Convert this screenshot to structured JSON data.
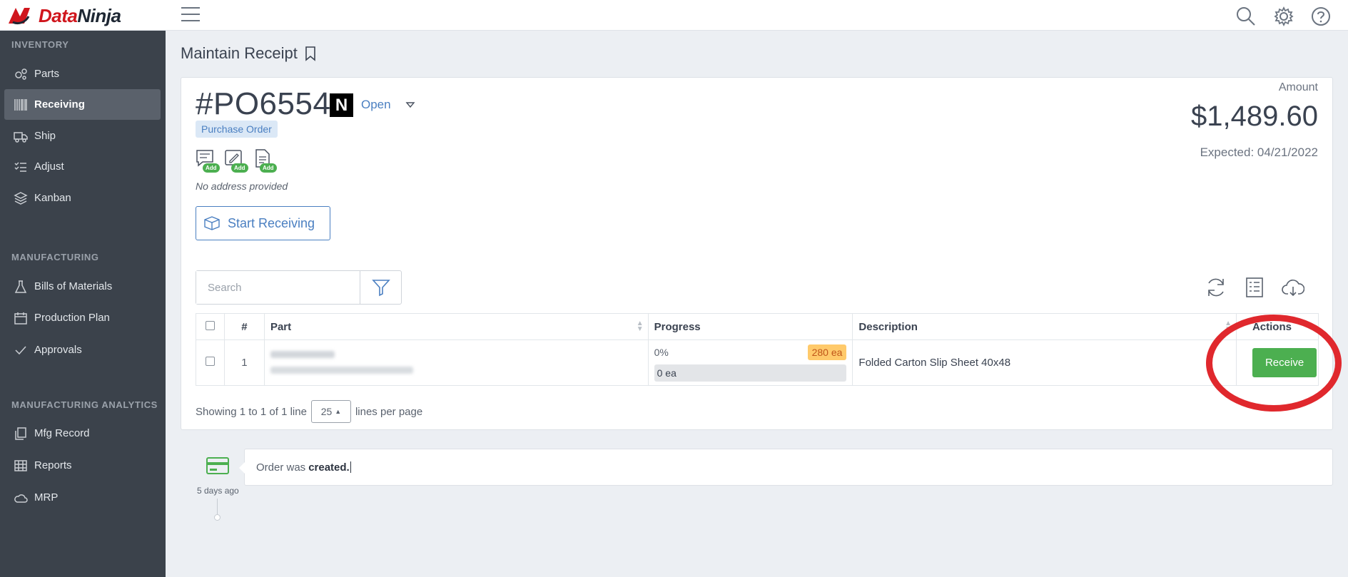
{
  "brand": {
    "name_part1": "Data",
    "name_part2": "Ninja"
  },
  "sidebar": {
    "sections": [
      {
        "title": "INVENTORY",
        "items": [
          {
            "label": "Parts",
            "icon": "gears-icon"
          },
          {
            "label": "Receiving",
            "icon": "barcode-icon",
            "active": true
          },
          {
            "label": "Ship",
            "icon": "truck-icon"
          },
          {
            "label": "Adjust",
            "icon": "checklist-icon"
          },
          {
            "label": "Kanban",
            "icon": "layers-icon"
          }
        ]
      },
      {
        "title": "MANUFACTURING",
        "items": [
          {
            "label": "Bills of Materials",
            "icon": "flask-icon"
          },
          {
            "label": "Production Plan",
            "icon": "calendar-icon"
          },
          {
            "label": "Approvals",
            "icon": "check-icon"
          }
        ]
      },
      {
        "title": "MANUFACTURING ANALYTICS",
        "items": [
          {
            "label": "Mfg Record",
            "icon": "copy-icon"
          },
          {
            "label": "Reports",
            "icon": "table-icon"
          },
          {
            "label": "MRP",
            "icon": "cloud-icon"
          }
        ]
      }
    ]
  },
  "page": {
    "title": "Maintain Receipt"
  },
  "order": {
    "number": "#PO6554",
    "badge_letter": "N",
    "status": "Open",
    "type": "Purchase Order",
    "add_badge": "Add",
    "no_address": "No address provided",
    "start_button": "Start Receiving",
    "amount_label": "Amount",
    "amount": "$1,489.60",
    "expected": "Expected: 04/21/2022"
  },
  "search": {
    "placeholder": "Search"
  },
  "table": {
    "headers": {
      "num": "#",
      "part": "Part",
      "progress": "Progress",
      "description": "Description",
      "actions": "Actions"
    },
    "rows": [
      {
        "num": "1",
        "progress_pct": "0%",
        "ordered_qty": "280 ea",
        "received_qty": "0 ea",
        "description": "Folded Carton Slip Sheet 40x48",
        "action": "Receive"
      }
    ]
  },
  "pagination": {
    "showing": "Showing 1 to 1 of 1 line",
    "per_page": "25",
    "per_page_suffix": "lines per page"
  },
  "timeline": {
    "time_ago": "5 days ago",
    "text_prefix": "Order was",
    "text_bold": "created."
  },
  "colors": {
    "accent": "#4a7fc1",
    "success": "#4caf50",
    "sidebar": "#3b424b",
    "highlight": "#e0282d"
  }
}
